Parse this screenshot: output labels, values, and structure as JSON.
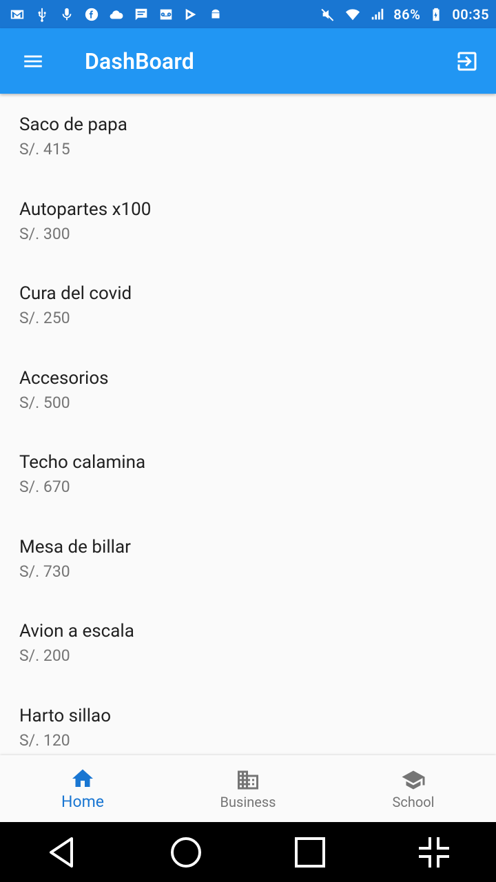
{
  "status_bar": {
    "battery": "86%",
    "time": "00:35",
    "left_icons": [
      "gmail-icon",
      "usb-icon",
      "mic-icon",
      "facebook-icon",
      "cloud-icon",
      "chat-icon",
      "voicemail-icon",
      "play-store-icon",
      "android-icon"
    ],
    "right_icons": [
      "mute-icon",
      "wifi-icon",
      "signal-icon",
      "battery-icon"
    ]
  },
  "appbar": {
    "title": "DashBoard",
    "background": "#2196F3"
  },
  "products": [
    {
      "name": "Saco de papa",
      "price": "S/. 415"
    },
    {
      "name": "Autopartes x100",
      "price": "S/. 300"
    },
    {
      "name": "Cura del covid",
      "price": "S/. 250"
    },
    {
      "name": "Accesorios",
      "price": "S/. 500"
    },
    {
      "name": "Techo calamina",
      "price": "S/. 670"
    },
    {
      "name": "Mesa de billar",
      "price": "S/. 730"
    },
    {
      "name": "Avion a escala",
      "price": "S/. 200"
    },
    {
      "name": "Harto sillao",
      "price": "S/. 120"
    }
  ],
  "bottom_nav": {
    "active_color": "#1976D2",
    "items": [
      {
        "label": "Home",
        "icon": "home-icon",
        "active": true
      },
      {
        "label": "Business",
        "icon": "business-icon",
        "active": false
      },
      {
        "label": "School",
        "icon": "school-icon",
        "active": false
      }
    ]
  }
}
